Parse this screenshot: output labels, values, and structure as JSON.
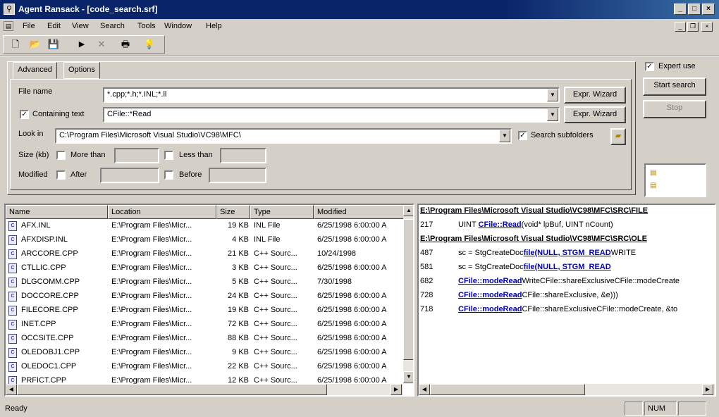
{
  "window": {
    "title": "Agent Ransack - [code_search.srf]"
  },
  "menu": [
    "File",
    "Edit",
    "View",
    "Search",
    "Tools",
    "Window",
    "Help"
  ],
  "toolbar": [
    "new-icon",
    "open-icon",
    "save-icon",
    "run-icon",
    "stop-icon",
    "print-icon",
    "help-icon"
  ],
  "tabs": {
    "advanced": "Advanced",
    "options": "Options"
  },
  "form": {
    "file_name_label": "File name",
    "file_name_value": "*.cpp;*.h;*.INL;*.ll",
    "containing_label": "Containing text",
    "containing_value": "CFile::*Read",
    "look_in_label": "Look in",
    "look_in_value": "C:\\Program Files\\Microsoft Visual Studio\\VC98\\MFC\\",
    "search_subfolders": "Search subfolders",
    "size_label": "Size (kb)",
    "more_than": "More than",
    "less_than": "Less than",
    "modified_label": "Modified",
    "after": "After",
    "before": "Before",
    "expr_wizard_1": "Expr. Wizard",
    "expr_wizard_2": "Expr. Wizard"
  },
  "side": {
    "expert_label": "Expert use",
    "start_button": "Start search",
    "stop_button": "Stop"
  },
  "list": {
    "columns": [
      "Name",
      "Location",
      "Size",
      "Type",
      "Modified"
    ],
    "rows": [
      {
        "name": "AFX.INL",
        "location": "E:\\Program Files\\Micr...",
        "size": "19 KB",
        "type": "INL File",
        "modified": "6/25/1998 6:00:00 A"
      },
      {
        "name": "AFXDISP.INL",
        "location": "E:\\Program Files\\Micr...",
        "size": "4 KB",
        "type": "INL File",
        "modified": "6/25/1998 6:00:00 A"
      },
      {
        "name": "ARCCORE.CPP",
        "location": "E:\\Program Files\\Micr...",
        "size": "21 KB",
        "type": "C++ Sourc...",
        "modified": "10/24/1998"
      },
      {
        "name": "CTLLIC.CPP",
        "location": "E:\\Program Files\\Micr...",
        "size": "3 KB",
        "type": "C++ Sourc...",
        "modified": "6/25/1998 6:00:00 A"
      },
      {
        "name": "DLGCOMM.CPP",
        "location": "E:\\Program Files\\Micr...",
        "size": "5 KB",
        "type": "C++ Sourc...",
        "modified": "7/30/1998"
      },
      {
        "name": "DOCCORE.CPP",
        "location": "E:\\Program Files\\Micr...",
        "size": "24 KB",
        "type": "C++ Sourc...",
        "modified": "6/25/1998 6:00:00 A"
      },
      {
        "name": "FILECORE.CPP",
        "location": "E:\\Program Files\\Micr...",
        "size": "19 KB",
        "type": "C++ Sourc...",
        "modified": "6/25/1998 6:00:00 A"
      },
      {
        "name": "INET.CPP",
        "location": "E:\\Program Files\\Micr...",
        "size": "72 KB",
        "type": "C++ Sourc...",
        "modified": "6/25/1998 6:00:00 A"
      },
      {
        "name": "OCCSITE.CPP",
        "location": "E:\\Program Files\\Micr...",
        "size": "88 KB",
        "type": "C++ Sourc...",
        "modified": "6/25/1998 6:00:00 A"
      },
      {
        "name": "OLEDOBJ1.CPP",
        "location": "E:\\Program Files\\Micr...",
        "size": "9 KB",
        "type": "C++ Sourc...",
        "modified": "6/25/1998 6:00:00 A"
      },
      {
        "name": "OLEDOC1.CPP",
        "location": "E:\\Program Files\\Micr...",
        "size": "22 KB",
        "type": "C++ Sourc...",
        "modified": "6/25/1998 6:00:00 A"
      },
      {
        "name": "PRFICT.CPP",
        "location": "E:\\Program Files\\Micr...",
        "size": "12 KB",
        "type": "C++ Sourc...",
        "modified": "6/25/1998 6:00:00 A"
      }
    ]
  },
  "results": {
    "lines": [
      {
        "kind": "path",
        "text": "E:\\Program Files\\Microsoft Visual Studio\\VC98\\MFC\\SRC\\FILE"
      },
      {
        "kind": "line",
        "num": "217",
        "pre": "UINT ",
        "hi": "CFile::Read",
        "post": "(void* lpBuf, UINT nCount)"
      },
      {
        "kind": "path",
        "text": "E:\\Program Files\\Microsoft Visual Studio\\VC98\\MFC\\SRC\\OLE"
      },
      {
        "kind": "line",
        "num": "487",
        "pre": "sc = StgCreateDoc",
        "hi": "file(NULL, STGM_READ",
        "post": "WRITE"
      },
      {
        "kind": "line",
        "num": "581",
        "pre": "sc = StgCreateDoc",
        "hi": "file(NULL, STGM_READ",
        "post": ""
      },
      {
        "kind": "line",
        "num": "682",
        "pre": "",
        "hi": "CFile::modeRead",
        "post": "WriteCFile::shareExclusiveCFile::modeCreate"
      },
      {
        "kind": "line",
        "num": "728",
        "pre": "",
        "hi": "CFile::modeRead",
        "post": "CFile::shareExclusive, &e)))"
      },
      {
        "kind": "line",
        "num": "718",
        "pre": "",
        "hi": "CFile::modeRead",
        "post": "CFile::shareExclusiveCFile::modeCreate, &to"
      }
    ]
  },
  "status": {
    "text": "Ready",
    "num": "NUM"
  }
}
